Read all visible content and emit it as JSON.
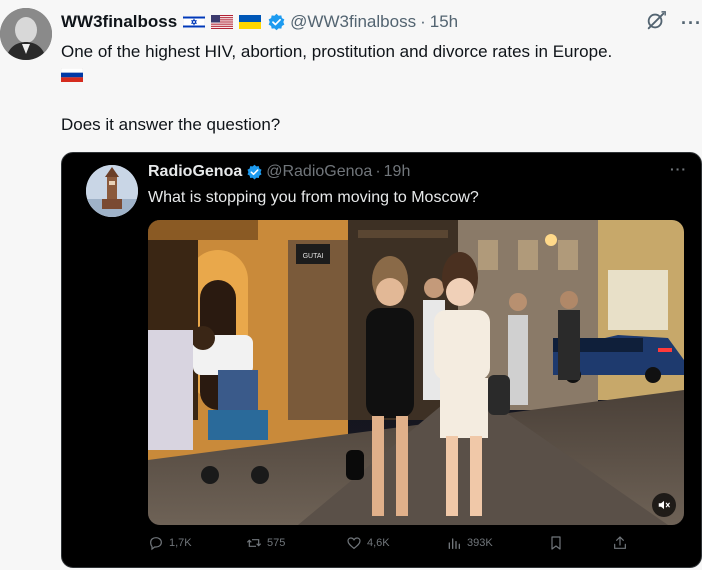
{
  "tweet": {
    "author_name": "WW3finalboss",
    "handle": "@WW3finalboss",
    "separator": "·",
    "time": "15h",
    "text": "One of the highest HIV, abortion, prostitution and divorce rates in Europe.",
    "question": "Does it answer the question?",
    "flags": [
      "israel-flag",
      "usa-flag",
      "ukraine-flag",
      "russia-flag"
    ],
    "verified_color": "#1d9bf0"
  },
  "quote": {
    "author_name": "RadioGenoa",
    "handle": "@RadioGenoa",
    "separator": "·",
    "time": "19h",
    "text": "What is stopping you from moving to Moscow?",
    "media_sign_text": "GUTAI",
    "actions": {
      "replies": "1,7K",
      "reposts": "575",
      "likes": "4,6K",
      "views": "393K"
    }
  },
  "icons": [
    "grok-icon",
    "more-icon",
    "verified-badge-icon",
    "reply-icon",
    "repost-icon",
    "like-icon",
    "views-icon",
    "bookmark-icon",
    "share-icon",
    "mute-icon"
  ]
}
